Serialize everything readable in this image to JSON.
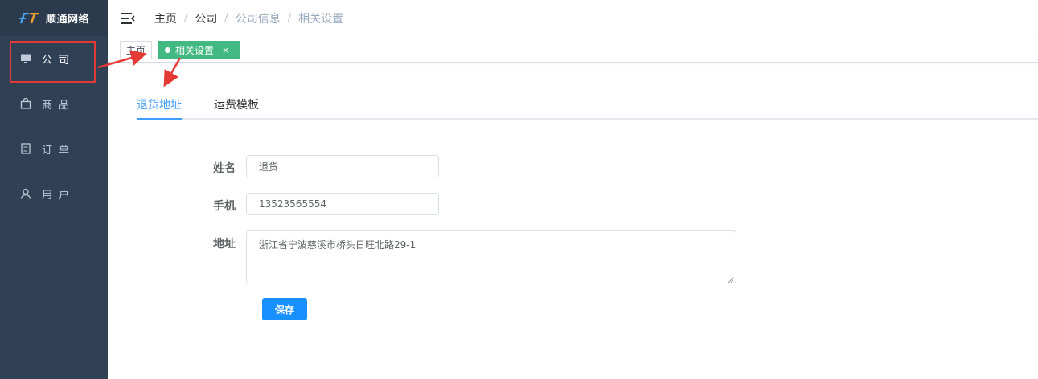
{
  "app": {
    "logo_text": "顺通网络",
    "colors": {
      "sidebar": "#304156",
      "accent": "#409eff",
      "tag_active": "#42b983",
      "button": "#1890ff",
      "annotation": "#e53935"
    }
  },
  "sidebar": {
    "items": [
      {
        "label": "公司",
        "icon": "monitor-icon"
      },
      {
        "label": "商品",
        "icon": "shopping-bag-icon"
      },
      {
        "label": "订单",
        "icon": "document-icon"
      },
      {
        "label": "用户",
        "icon": "user-icon"
      }
    ]
  },
  "header": {
    "breadcrumb": [
      "主页",
      "公司",
      "公司信息",
      "相关设置"
    ]
  },
  "tags": {
    "home": "主页",
    "active": "相关设置",
    "close": "×"
  },
  "tabs": [
    "退货地址",
    "运费模板"
  ],
  "form": {
    "name_label": "姓名",
    "name_value": "退货",
    "phone_label": "手机",
    "phone_value": "13523565554",
    "address_label": "地址",
    "address_value": "浙江省宁波慈溪市桥头日旺北路29-1",
    "save_label": "保存"
  }
}
